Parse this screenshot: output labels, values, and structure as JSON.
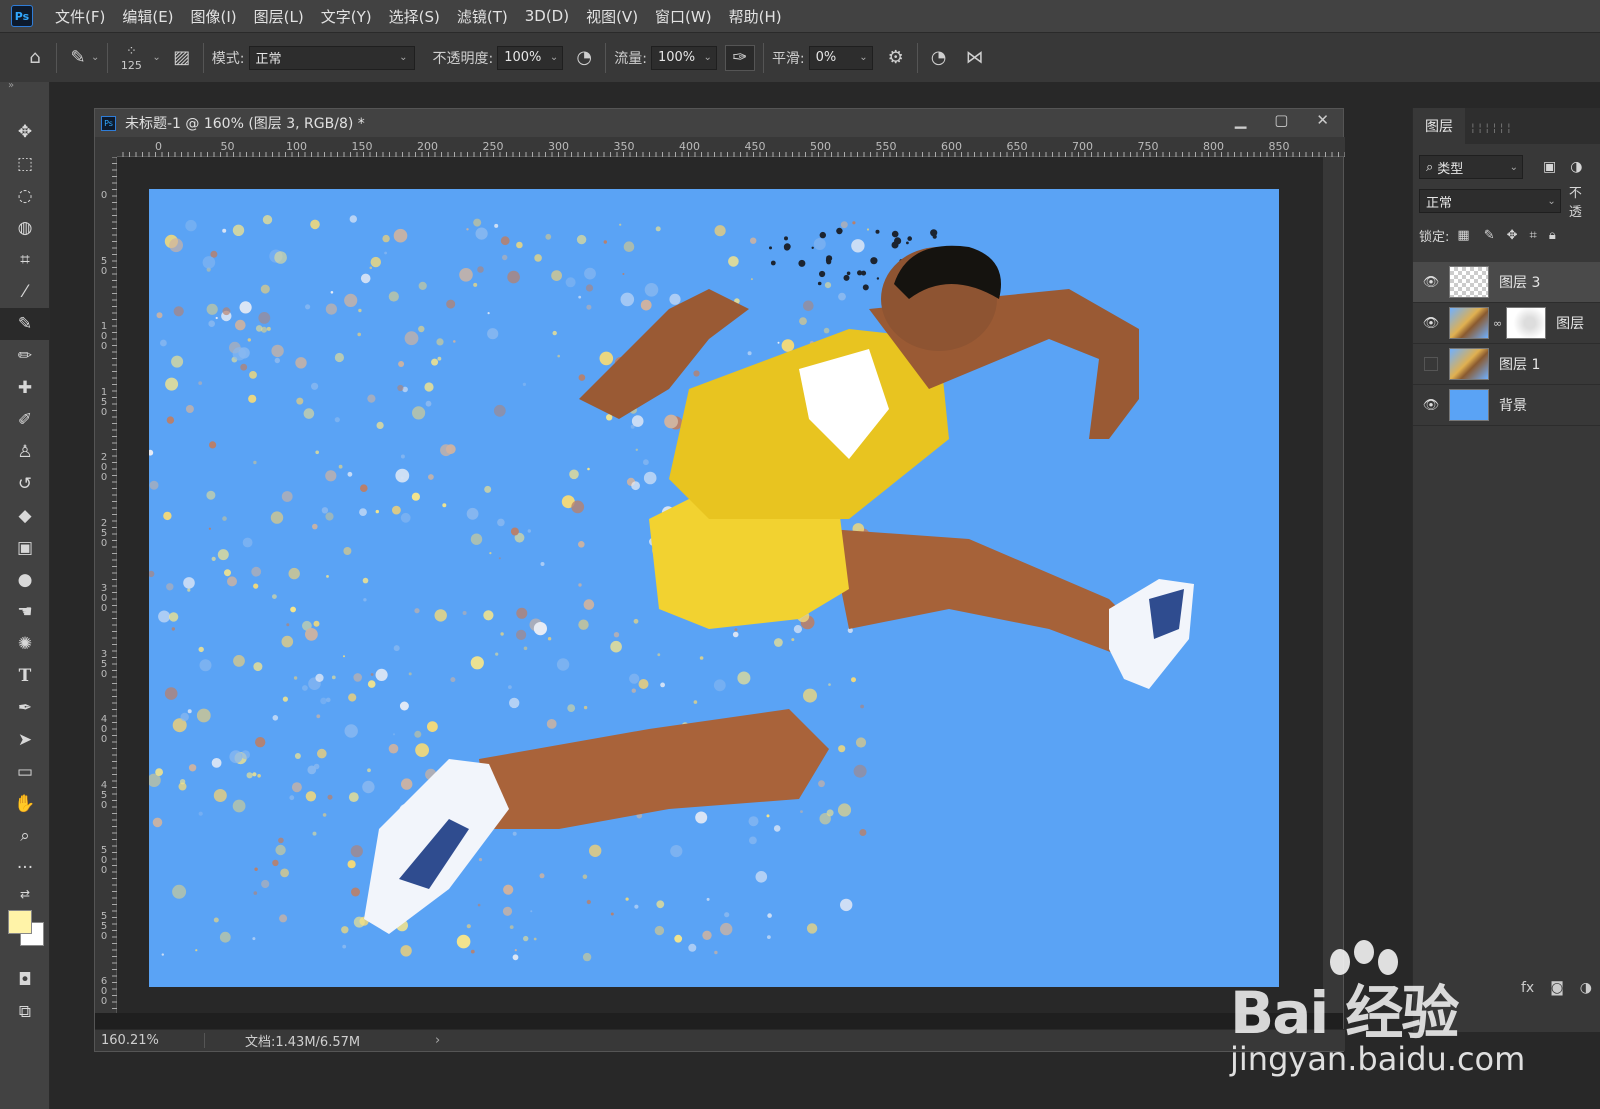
{
  "app": {
    "logo": "Ps"
  },
  "menu": [
    "文件(F)",
    "编辑(E)",
    "图像(I)",
    "图层(L)",
    "文字(Y)",
    "选择(S)",
    "滤镜(T)",
    "3D(D)",
    "视图(V)",
    "窗口(W)",
    "帮助(H)"
  ],
  "options": {
    "brush_size": "125",
    "mode_label": "模式:",
    "mode_value": "正常",
    "opacity_label": "不透明度:",
    "opacity_value": "100%",
    "flow_label": "流量:",
    "flow_value": "100%",
    "smooth_label": "平滑:",
    "smooth_value": "0%"
  },
  "document": {
    "title": "未标题-1 @ 160% (图层 3, RGB/8) *",
    "zoom": "160.21%",
    "doc_info": "文档:1.43M/6.57M",
    "ruler_top": [
      "0",
      "50",
      "100",
      "150",
      "200",
      "250",
      "300",
      "350",
      "400",
      "450",
      "500",
      "550",
      "600",
      "650",
      "700",
      "750",
      "800",
      "850"
    ],
    "ruler_left": [
      "0",
      "50",
      "100",
      "150",
      "200",
      "250",
      "300",
      "350",
      "400",
      "450",
      "500",
      "550",
      "600"
    ],
    "canvas_color": "#5aa3f5"
  },
  "colors": {
    "foreground": "#fff3a8",
    "background": "#ffffff"
  },
  "layers_panel": {
    "tab": "图层",
    "filter_label": "类型",
    "blend_mode": "正常",
    "opacity_label": "不透",
    "lock_label": "锁定:",
    "layers": [
      {
        "name": "图层 3",
        "visible": true,
        "thumb": "checker",
        "active": true
      },
      {
        "name": "图层",
        "visible": true,
        "thumb": "photo",
        "mask": true,
        "active": false
      },
      {
        "name": "图层 1",
        "visible": false,
        "thumb": "photo",
        "active": false
      },
      {
        "name": "背景",
        "visible": true,
        "thumb": "blue",
        "active": false
      }
    ]
  },
  "watermark": {
    "big": "Bai 经验",
    "small": "jingyan.baidu.com"
  }
}
